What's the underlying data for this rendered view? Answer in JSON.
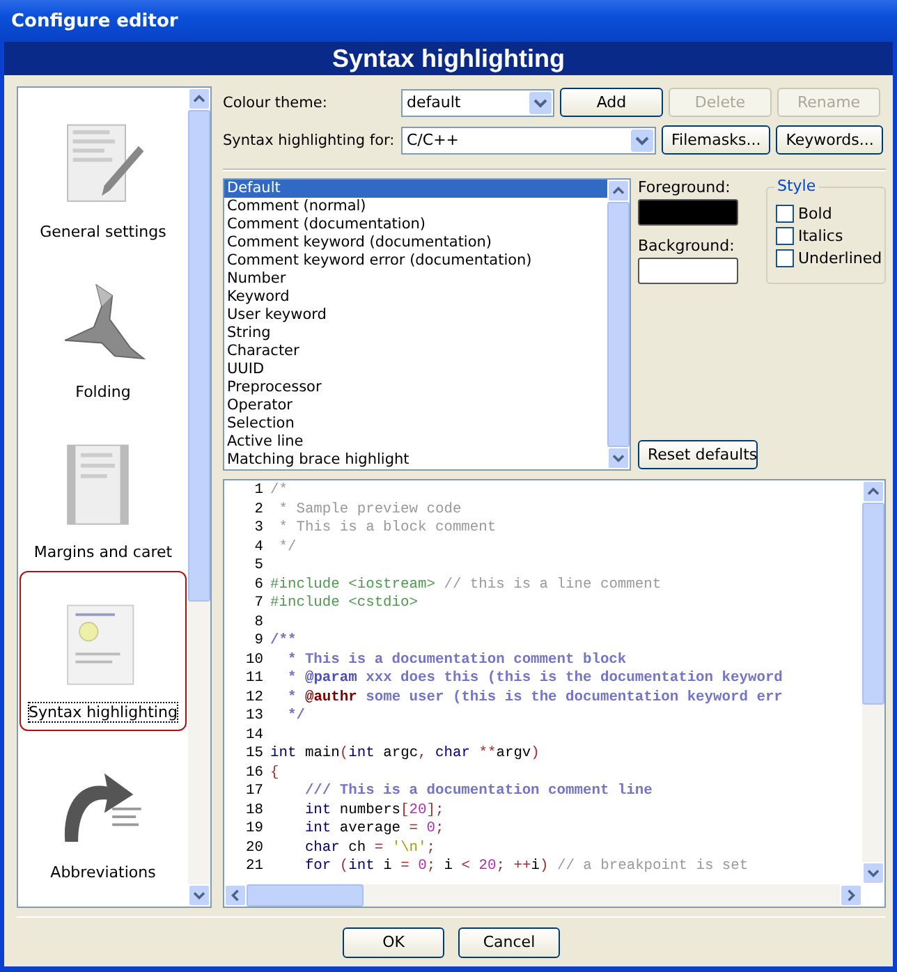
{
  "window": {
    "title": "Configure editor"
  },
  "header": {
    "title": "Syntax highlighting"
  },
  "sidebar": {
    "items": [
      {
        "label": "General settings",
        "kind": "page-pencil",
        "selected": false
      },
      {
        "label": "Folding",
        "kind": "origami",
        "selected": false
      },
      {
        "label": "Margins and caret",
        "kind": "margins",
        "selected": false
      },
      {
        "label": "Syntax highlighting",
        "kind": "bulb",
        "selected": true
      },
      {
        "label": "Abbreviations",
        "kind": "arrow",
        "selected": false
      }
    ]
  },
  "theme": {
    "label": "Colour theme:",
    "value": "default",
    "buttons": [
      {
        "label": "Add",
        "disabled": false
      },
      {
        "label": "Delete",
        "disabled": true
      },
      {
        "label": "Rename",
        "disabled": true
      }
    ]
  },
  "language": {
    "label": "Syntax highlighting for:",
    "value": "C/C++",
    "buttons": [
      {
        "label": "Filemasks...",
        "disabled": false
      },
      {
        "label": "Keywords...",
        "disabled": false
      }
    ]
  },
  "styles_list": {
    "items": [
      {
        "label": "Default",
        "selected": true
      },
      {
        "label": "Comment (normal)",
        "selected": false
      },
      {
        "label": "Comment (documentation)",
        "selected": false
      },
      {
        "label": "Comment keyword (documentation)",
        "selected": false
      },
      {
        "label": "Comment keyword error (documentation)",
        "selected": false
      },
      {
        "label": "Number",
        "selected": false
      },
      {
        "label": "Keyword",
        "selected": false
      },
      {
        "label": "User keyword",
        "selected": false
      },
      {
        "label": "String",
        "selected": false
      },
      {
        "label": "Character",
        "selected": false
      },
      {
        "label": "UUID",
        "selected": false
      },
      {
        "label": "Preprocessor",
        "selected": false
      },
      {
        "label": "Operator",
        "selected": false
      },
      {
        "label": "Selection",
        "selected": false
      },
      {
        "label": "Active line",
        "selected": false
      },
      {
        "label": "Matching brace highlight",
        "selected": false
      }
    ]
  },
  "foreground": {
    "label": "Foreground:",
    "color": "#000000"
  },
  "background": {
    "label": "Background:",
    "color": "#ffffff"
  },
  "style_group": {
    "title": "Style",
    "options": [
      {
        "label": "Bold",
        "checked": false
      },
      {
        "label": "Italics",
        "checked": false
      },
      {
        "label": "Underlined",
        "checked": false
      }
    ]
  },
  "reset_button": "Reset defaults",
  "preview": {
    "lines": [
      {
        "number": "1",
        "tokens": [
          {
            "kind": "comment",
            "text": "/*"
          }
        ]
      },
      {
        "number": "2",
        "tokens": [
          {
            "kind": "comment",
            "text": " * Sample preview code"
          }
        ]
      },
      {
        "number": "3",
        "tokens": [
          {
            "kind": "comment",
            "text": " * This is a block comment"
          }
        ]
      },
      {
        "number": "4",
        "tokens": [
          {
            "kind": "comment",
            "text": " */"
          }
        ]
      },
      {
        "number": "5"
      },
      {
        "number": "6",
        "tokens": [
          {
            "kind": "preproc",
            "text": "#include <iostream> "
          },
          {
            "kind": "comment",
            "text": "// this is a line comment"
          }
        ]
      },
      {
        "number": "7",
        "tokens": [
          {
            "kind": "preproc",
            "text": "#include <cstdio>"
          }
        ]
      },
      {
        "number": "8"
      },
      {
        "number": "9",
        "tokens": [
          {
            "kind": "doc",
            "text": "/**"
          }
        ]
      },
      {
        "number": "10",
        "tokens": [
          {
            "kind": "doc",
            "text": "  * This is a documentation comment block"
          }
        ]
      },
      {
        "number": "11",
        "tokens": [
          {
            "kind": "doc",
            "text": "  * "
          },
          {
            "kind": "dockw",
            "text": "@param"
          },
          {
            "kind": "doc",
            "text": " xxx does this (this is the documentation keyword"
          }
        ]
      },
      {
        "number": "12",
        "tokens": [
          {
            "kind": "doc",
            "text": "  * "
          },
          {
            "kind": "dockerr",
            "text": "@authr"
          },
          {
            "kind": "doc",
            "text": " some user (this is the documentation keyword err"
          }
        ]
      },
      {
        "number": "13",
        "tokens": [
          {
            "kind": "doc",
            "text": "  */"
          }
        ]
      },
      {
        "number": "14"
      },
      {
        "number": "15",
        "tokens": [
          {
            "kind": "keyword",
            "text": "int"
          },
          {
            "kind": "plain",
            "text": " main"
          },
          {
            "kind": "op",
            "text": "("
          },
          {
            "kind": "keyword",
            "text": "int"
          },
          {
            "kind": "plain",
            "text": " argc"
          },
          {
            "kind": "op",
            "text": ","
          },
          {
            "kind": "keyword",
            "text": " char"
          },
          {
            "kind": "op",
            "text": " **"
          },
          {
            "kind": "plain",
            "text": "argv"
          },
          {
            "kind": "op",
            "text": ")"
          }
        ]
      },
      {
        "number": "16",
        "tokens": [
          {
            "kind": "op",
            "text": "{"
          }
        ]
      },
      {
        "number": "17",
        "tokens": [
          {
            "kind": "doc",
            "text": "    /// This is a documentation comment line"
          }
        ]
      },
      {
        "number": "18",
        "tokens": [
          {
            "kind": "keyword",
            "text": "    int"
          },
          {
            "kind": "plain",
            "text": " numbers"
          },
          {
            "kind": "op",
            "text": "["
          },
          {
            "kind": "number",
            "text": "20"
          },
          {
            "kind": "op",
            "text": "];"
          }
        ]
      },
      {
        "number": "19",
        "tokens": [
          {
            "kind": "keyword",
            "text": "    int"
          },
          {
            "kind": "plain",
            "text": " average "
          },
          {
            "kind": "op",
            "text": "="
          },
          {
            "kind": "number",
            "text": " 0"
          },
          {
            "kind": "op",
            "text": ";"
          }
        ]
      },
      {
        "number": "20",
        "tokens": [
          {
            "kind": "keyword",
            "text": "    char"
          },
          {
            "kind": "plain",
            "text": " ch "
          },
          {
            "kind": "op",
            "text": "="
          },
          {
            "kind": "string",
            "text": " '\\n'"
          },
          {
            "kind": "op",
            "text": ";"
          }
        ]
      },
      {
        "number": "21",
        "tokens": [
          {
            "kind": "keyword",
            "text": "    for"
          },
          {
            "kind": "op",
            "text": " ("
          },
          {
            "kind": "keyword",
            "text": "int"
          },
          {
            "kind": "plain",
            "text": " i "
          },
          {
            "kind": "op",
            "text": "="
          },
          {
            "kind": "number",
            "text": " 0"
          },
          {
            "kind": "op",
            "text": ";"
          },
          {
            "kind": "plain",
            "text": " i "
          },
          {
            "kind": "op",
            "text": "<"
          },
          {
            "kind": "number",
            "text": " 20"
          },
          {
            "kind": "op",
            "text": ";"
          },
          {
            "kind": "op",
            "text": " ++"
          },
          {
            "kind": "plain",
            "text": "i"
          },
          {
            "kind": "op",
            "text": ")"
          },
          {
            "kind": "comment",
            "text": " // a breakpoint is set"
          }
        ]
      }
    ]
  },
  "buttons": [
    {
      "label": "OK"
    },
    {
      "label": "Cancel"
    }
  ]
}
